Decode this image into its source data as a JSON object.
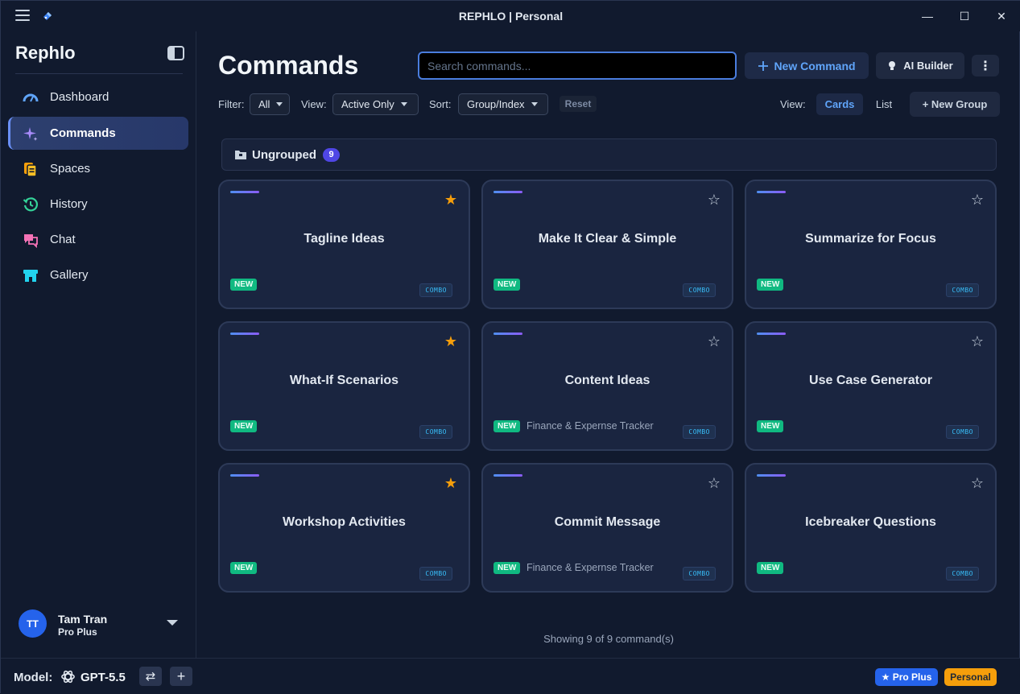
{
  "window": {
    "title": "REPHLO | Personal",
    "minimize_glyph": "—",
    "maximize_glyph": "☐",
    "close_glyph": "✕"
  },
  "sidebar": {
    "brand": "Rephlo",
    "items": [
      {
        "label": "Dashboard",
        "icon": "gauge-icon",
        "color": "#60a5fa"
      },
      {
        "label": "Commands",
        "icon": "sparkles-icon",
        "color": "#a78bfa",
        "active": true
      },
      {
        "label": "Spaces",
        "icon": "documents-icon",
        "color": "#f59e0b"
      },
      {
        "label": "History",
        "icon": "history-icon",
        "color": "#34d399"
      },
      {
        "label": "Chat",
        "icon": "chat-icon",
        "color": "#f472b6"
      },
      {
        "label": "Gallery",
        "icon": "store-icon",
        "color": "#22d3ee"
      }
    ],
    "user": {
      "initials": "TT",
      "name": "Tam Tran",
      "plan": "Pro Plus"
    }
  },
  "header": {
    "title": "Commands",
    "search_placeholder": "Search commands...",
    "new_command": "New Command",
    "ai_builder": "AI Builder",
    "more": "⋮"
  },
  "filters": {
    "filter_label": "Filter:",
    "filter_value": "All",
    "view_label": "View:",
    "view_value": "Active Only",
    "sort_label": "Sort:",
    "sort_value": "Group/Index",
    "reset": "Reset",
    "display_label": "View:",
    "display_cards": "Cards",
    "display_list": "List",
    "new_group": "+ New Group"
  },
  "group": {
    "label": "Ungrouped",
    "count": "9"
  },
  "cards": [
    {
      "title": "Tagline Ideas",
      "starred": true,
      "badge": "NEW",
      "space": "",
      "combo": "COMBO"
    },
    {
      "title": "Make It Clear & Simple",
      "starred": false,
      "badge": "NEW",
      "space": "",
      "combo": "COMBO"
    },
    {
      "title": "Summarize for Focus",
      "starred": false,
      "badge": "NEW",
      "space": "",
      "combo": "COMBO"
    },
    {
      "title": "What-If Scenarios",
      "starred": true,
      "badge": "NEW",
      "space": "",
      "combo": "COMBO"
    },
    {
      "title": "Content Ideas",
      "starred": false,
      "badge": "NEW",
      "space": "Finance & Expernse Tracker",
      "combo": "COMBO"
    },
    {
      "title": "Use Case Generator",
      "starred": false,
      "badge": "NEW",
      "space": "",
      "combo": "COMBO"
    },
    {
      "title": "Workshop Activities",
      "starred": true,
      "badge": "NEW",
      "space": "",
      "combo": "COMBO"
    },
    {
      "title": "Commit Message",
      "starred": false,
      "badge": "NEW",
      "space": "Finance & Expernse Tracker",
      "combo": "COMBO"
    },
    {
      "title": "Icebreaker Questions",
      "starred": false,
      "badge": "NEW",
      "space": "",
      "combo": "COMBO"
    }
  ],
  "footer_text": "Showing 9 of 9 command(s)",
  "bottombar": {
    "model_label": "Model:",
    "model_name": "GPT-5.5",
    "swap_glyph": "⇄",
    "add_glyph": "+",
    "pro_badge": "★ Pro Plus",
    "personal_badge": "Personal"
  },
  "colors": {
    "accent": "#60a5fa",
    "star_active": "#f59e0b",
    "star_inactive": "#cbd5e1",
    "new_badge": "#10b981"
  }
}
